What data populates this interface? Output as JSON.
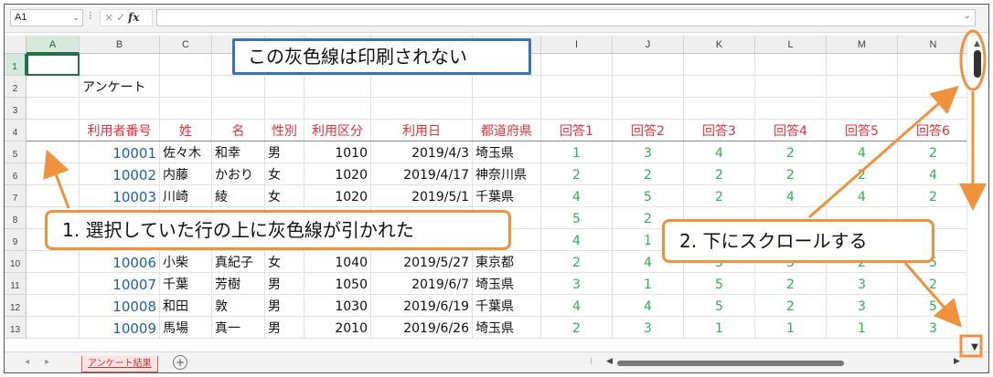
{
  "formula_bar": {
    "name_box": "A1",
    "fx_label": "fx",
    "cancel_glyph": "×",
    "enter_glyph": "✓",
    "formula_value": ""
  },
  "columns": [
    "A",
    "B",
    "C",
    "D",
    "E",
    "F",
    "G",
    "H",
    "I",
    "J",
    "K",
    "L",
    "M",
    "N"
  ],
  "selected_column": "A",
  "rows": [
    1,
    2,
    3,
    4,
    5,
    6,
    7,
    8,
    9,
    10,
    11,
    12,
    13
  ],
  "selected_row": 1,
  "title_cell": "アンケート",
  "headers": [
    "利用者番号",
    "姓",
    "名",
    "性別",
    "利用区分",
    "利用日",
    "都道府県",
    "回答1",
    "回答2",
    "回答3",
    "回答4",
    "回答5",
    "回答6"
  ],
  "records": [
    {
      "id": "10001",
      "sei": "佐々木",
      "mei": "和幸",
      "gender": "男",
      "kubun": "1010",
      "date": "2019/4/3",
      "pref": "埼玉県",
      "answers": [
        "1",
        "3",
        "4",
        "2",
        "4",
        "2"
      ]
    },
    {
      "id": "10002",
      "sei": "内藤",
      "mei": "かおり",
      "gender": "女",
      "kubun": "1020",
      "date": "2019/4/17",
      "pref": "神奈川県",
      "answers": [
        "2",
        "2",
        "2",
        "2",
        "2",
        "4"
      ]
    },
    {
      "id": "10003",
      "sei": "川崎",
      "mei": "綾",
      "gender": "女",
      "kubun": "1020",
      "date": "2019/5/1",
      "pref": "千葉県",
      "answers": [
        "4",
        "5",
        "2",
        "4",
        "4",
        "2"
      ]
    },
    {
      "id": "",
      "sei": "",
      "mei": "",
      "gender": "",
      "kubun": "",
      "date": "",
      "pref": "",
      "answers": [
        "5",
        "2",
        "",
        "",
        "",
        ""
      ]
    },
    {
      "id": "",
      "sei": "",
      "mei": "",
      "gender": "",
      "kubun": "",
      "date": "",
      "pref": "川県",
      "answers": [
        "4",
        "1",
        "",
        "",
        "",
        ""
      ]
    },
    {
      "id": "10006",
      "sei": "小柴",
      "mei": "真紀子",
      "gender": "女",
      "kubun": "1040",
      "date": "2019/5/27",
      "pref": "東京都",
      "answers": [
        "2",
        "4",
        "5",
        "3",
        "2",
        "5"
      ]
    },
    {
      "id": "10007",
      "sei": "千葉",
      "mei": "芳樹",
      "gender": "男",
      "kubun": "1050",
      "date": "2019/6/7",
      "pref": "埼玉県",
      "answers": [
        "3",
        "1",
        "5",
        "2",
        "3",
        "2"
      ]
    },
    {
      "id": "10008",
      "sei": "和田",
      "mei": "敦",
      "gender": "男",
      "kubun": "1030",
      "date": "2019/6/19",
      "pref": "千葉県",
      "answers": [
        "4",
        "4",
        "5",
        "2",
        "3",
        "5"
      ]
    },
    {
      "id": "10009",
      "sei": "馬場",
      "mei": "真一",
      "gender": "男",
      "kubun": "2010",
      "date": "2019/6/26",
      "pref": "埼玉県",
      "answers": [
        "2",
        "3",
        "1",
        "1",
        "1",
        "3"
      ]
    }
  ],
  "sheet_tab": "アンケート結果",
  "add_sheet_glyph": "+",
  "callouts": {
    "gray_line_note": "この灰色線は印刷されない",
    "step1": "1. 選択していた行の上に灰色線が引かれた",
    "step2": "2. 下にスクロールする"
  },
  "colors": {
    "header_text": "#e8303a",
    "id_text": "#1f5fb0",
    "answer_text": "#2eb34f",
    "callout_orange": "#f0913c",
    "callout_blue": "#3a74b8",
    "sheet_tab": "#c43b3b"
  },
  "icons": {
    "name_box_dropdown": "chevron-down-icon",
    "scroll_up": "triangle-up-icon",
    "scroll_down": "triangle-down-icon",
    "add_sheet": "plus-circle-icon"
  }
}
